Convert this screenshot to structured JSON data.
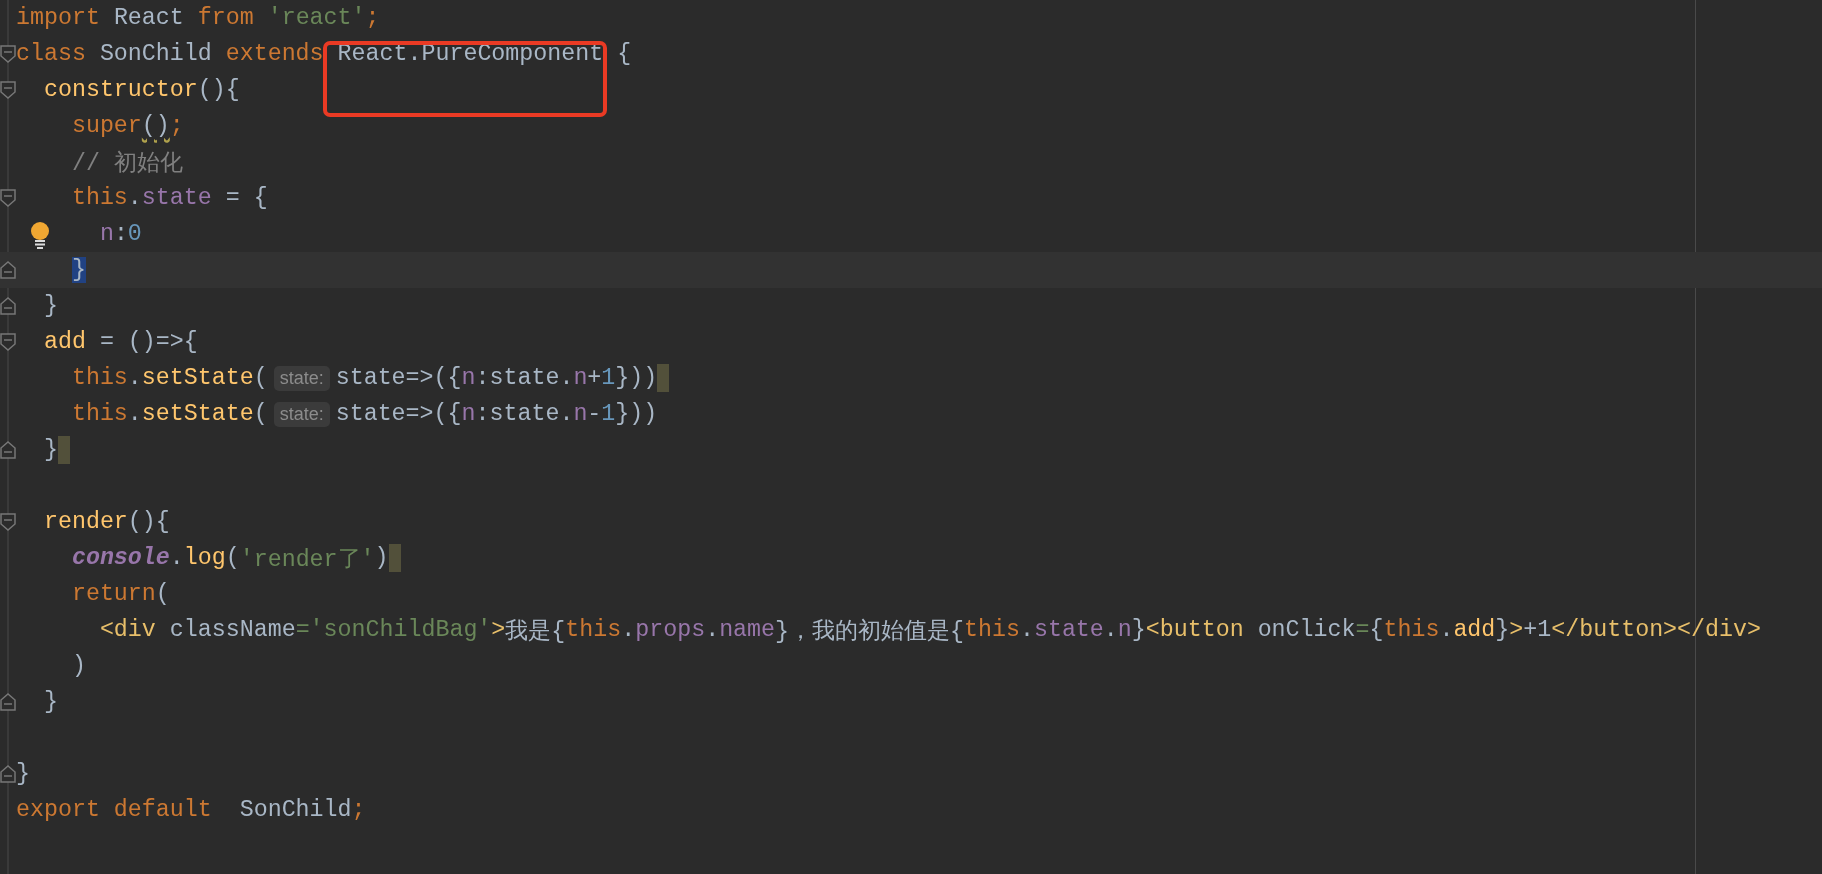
{
  "lines": [
    {
      "kind": "code",
      "tokens": [
        {
          "text": "import",
          "kind": "keyword"
        },
        {
          "text": " React ",
          "kind": "ident"
        },
        {
          "text": "from",
          "kind": "keyword"
        },
        {
          "text": " 'react'",
          "kind": "string"
        },
        {
          "text": ";",
          "kind": "keyword"
        }
      ]
    },
    {
      "kind": "code",
      "tokens": [
        {
          "text": "class",
          "kind": "keyword"
        },
        {
          "text": " SonChild ",
          "kind": "ident"
        },
        {
          "text": "extends",
          "kind": "keyword"
        },
        {
          "text": " React.PureComponent {",
          "kind": "ident"
        }
      ],
      "fold_start": true
    },
    {
      "kind": "code",
      "tokens": [
        {
          "text": "  constructor",
          "kind": "func"
        },
        {
          "text": "(){",
          "kind": "ident"
        }
      ],
      "fold_start": true
    },
    {
      "kind": "code",
      "tokens": [
        {
          "text": "    super",
          "kind": "keyword"
        },
        {
          "text": "()",
          "kind": "warn"
        },
        {
          "text": ";",
          "kind": "keyword"
        }
      ]
    },
    {
      "kind": "code",
      "tokens": [
        {
          "text": "    // 初始化",
          "kind": "comment"
        }
      ]
    },
    {
      "kind": "code",
      "tokens": [
        {
          "text": "    this",
          "kind": "keyword"
        },
        {
          "text": ".",
          "kind": "ident"
        },
        {
          "text": "state",
          "kind": "prop"
        },
        {
          "text": " = {",
          "kind": "ident"
        }
      ],
      "fold_start": true
    },
    {
      "kind": "code",
      "tokens": [
        {
          "text": "      n",
          "kind": "prop"
        },
        {
          "text": ":",
          "kind": "ident"
        },
        {
          "text": "0",
          "kind": "number"
        }
      ],
      "bulb": true
    },
    {
      "kind": "code",
      "tokens": [
        {
          "text": "    }",
          "kind": "match"
        }
      ],
      "fold_end": true,
      "current": true
    },
    {
      "kind": "code",
      "tokens": [
        {
          "text": "  }",
          "kind": "ident"
        }
      ],
      "fold_end": true
    },
    {
      "kind": "code",
      "tokens": [
        {
          "text": "  add",
          "kind": "func"
        },
        {
          "text": " = ()=>{",
          "kind": "ident"
        }
      ],
      "fold_start": true
    },
    {
      "kind": "code",
      "tokens": [
        {
          "text": "    this",
          "kind": "keyword"
        },
        {
          "text": ".",
          "kind": "ident"
        },
        {
          "text": "setState",
          "kind": "func"
        },
        {
          "text": "(",
          "kind": "ident"
        },
        {
          "text": "state:",
          "kind": "hint"
        },
        {
          "text": "state=>({",
          "kind": "ident"
        },
        {
          "text": "n",
          "kind": "prop"
        },
        {
          "text": ":state.",
          "kind": "ident"
        },
        {
          "text": "n",
          "kind": "prop"
        },
        {
          "text": "+",
          "kind": "ident"
        },
        {
          "text": "1",
          "kind": "number"
        },
        {
          "text": "}))",
          "kind": "ident"
        }
      ],
      "end_mark": true
    },
    {
      "kind": "code",
      "tokens": [
        {
          "text": "    this",
          "kind": "keyword"
        },
        {
          "text": ".",
          "kind": "ident"
        },
        {
          "text": "setState",
          "kind": "func"
        },
        {
          "text": "(",
          "kind": "ident"
        },
        {
          "text": "state:",
          "kind": "hint"
        },
        {
          "text": "state=>({",
          "kind": "ident"
        },
        {
          "text": "n",
          "kind": "prop"
        },
        {
          "text": ":state.",
          "kind": "ident"
        },
        {
          "text": "n",
          "kind": "prop"
        },
        {
          "text": "-",
          "kind": "ident"
        },
        {
          "text": "1",
          "kind": "number"
        },
        {
          "text": "}))",
          "kind": "ident"
        }
      ]
    },
    {
      "kind": "code",
      "tokens": [
        {
          "text": "  }",
          "kind": "ident"
        }
      ],
      "fold_end": true,
      "end_mark": true
    },
    {
      "kind": "blank"
    },
    {
      "kind": "code",
      "tokens": [
        {
          "text": "  render",
          "kind": "func"
        },
        {
          "text": "(){",
          "kind": "ident"
        }
      ],
      "fold_start": true
    },
    {
      "kind": "code",
      "tokens": [
        {
          "text": "    console",
          "kind": "global"
        },
        {
          "text": ".",
          "kind": "ident"
        },
        {
          "text": "log",
          "kind": "func"
        },
        {
          "text": "(",
          "kind": "ident"
        },
        {
          "text": "'render了'",
          "kind": "string"
        },
        {
          "text": ")",
          "kind": "ident"
        }
      ],
      "end_mark": true
    },
    {
      "kind": "code",
      "tokens": [
        {
          "text": "    return",
          "kind": "keyword"
        },
        {
          "text": "(",
          "kind": "ident"
        }
      ]
    },
    {
      "kind": "code",
      "tokens": [
        {
          "text": "      <div",
          "kind": "tag"
        },
        {
          "text": " className",
          "kind": "ident"
        },
        {
          "text": "=",
          "kind": "string"
        },
        {
          "text": "'sonChildBag'",
          "kind": "string"
        },
        {
          "text": ">",
          "kind": "tag"
        },
        {
          "text": "我是{",
          "kind": "ident"
        },
        {
          "text": "this",
          "kind": "keyword"
        },
        {
          "text": ".",
          "kind": "ident"
        },
        {
          "text": "props",
          "kind": "prop"
        },
        {
          "text": ".",
          "kind": "ident"
        },
        {
          "text": "name",
          "kind": "prop"
        },
        {
          "text": "}，我的初始值是{",
          "kind": "ident"
        },
        {
          "text": "this",
          "kind": "keyword"
        },
        {
          "text": ".",
          "kind": "ident"
        },
        {
          "text": "state",
          "kind": "prop"
        },
        {
          "text": ".",
          "kind": "ident"
        },
        {
          "text": "n",
          "kind": "prop"
        },
        {
          "text": "}",
          "kind": "ident"
        },
        {
          "text": "<button",
          "kind": "tag"
        },
        {
          "text": " onClick",
          "kind": "ident"
        },
        {
          "text": "=",
          "kind": "string"
        },
        {
          "text": "{",
          "kind": "ident"
        },
        {
          "text": "this",
          "kind": "keyword"
        },
        {
          "text": ".",
          "kind": "ident"
        },
        {
          "text": "add",
          "kind": "func"
        },
        {
          "text": "}",
          "kind": "ident"
        },
        {
          "text": ">",
          "kind": "tag"
        },
        {
          "text": "+1",
          "kind": "ident"
        },
        {
          "text": "</button></div>",
          "kind": "tag"
        }
      ]
    },
    {
      "kind": "code",
      "tokens": [
        {
          "text": "    )",
          "kind": "ident"
        }
      ]
    },
    {
      "kind": "code",
      "tokens": [
        {
          "text": "  }",
          "kind": "ident"
        }
      ],
      "fold_end": true
    },
    {
      "kind": "blank"
    },
    {
      "kind": "code",
      "tokens": [
        {
          "text": "}",
          "kind": "ident"
        }
      ],
      "fold_end": true
    },
    {
      "kind": "code",
      "tokens": [
        {
          "text": "export default",
          "kind": "keyword"
        },
        {
          "text": "  SonChild",
          "kind": "ident"
        },
        {
          "text": ";",
          "kind": "keyword"
        }
      ]
    }
  ]
}
